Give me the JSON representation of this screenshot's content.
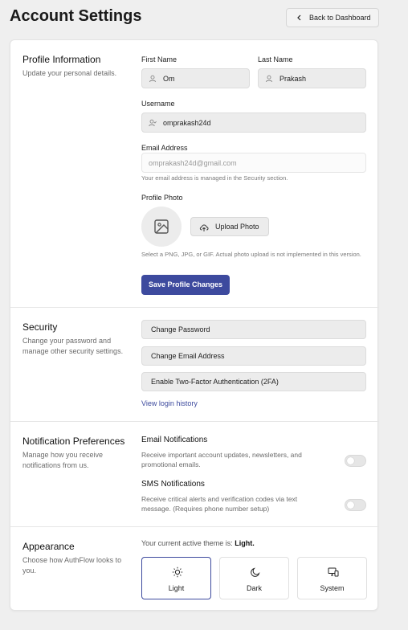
{
  "header": {
    "title": "Account Settings",
    "back_label": "Back to Dashboard"
  },
  "profile": {
    "title": "Profile Information",
    "description": "Update your personal details.",
    "first_name_label": "First Name",
    "first_name_value": "Om",
    "last_name_label": "Last Name",
    "last_name_value": "Prakash",
    "username_label": "Username",
    "username_value": "omprakash24d",
    "email_label": "Email Address",
    "email_value": "omprakash24d@gmail.com",
    "email_hint": "Your email address is managed in the Security section.",
    "photo_label": "Profile Photo",
    "upload_label": "Upload Photo",
    "photo_hint": "Select a PNG, JPG, or GIF. Actual photo upload is not implemented in this version.",
    "save_label": "Save Profile Changes"
  },
  "security": {
    "title": "Security",
    "description": "Change your password and manage other security settings.",
    "buttons": [
      "Change Password",
      "Change Email Address",
      "Enable Two-Factor Authentication (2FA)"
    ],
    "history_link": "View login history"
  },
  "notifications": {
    "title": "Notification Preferences",
    "description": "Manage how you receive notifications from us.",
    "email_title": "Email Notifications",
    "email_desc": "Receive important account updates, newsletters, and promotional emails.",
    "email_enabled": false,
    "sms_title": "SMS Notifications",
    "sms_desc": "Receive critical alerts and verification codes via text message. (Requires phone number setup)",
    "sms_enabled": false
  },
  "appearance": {
    "title": "Appearance",
    "description": "Choose how AuthFlow looks to you.",
    "current_prefix": "Your current active theme is:",
    "current_theme": "Light.",
    "themes": [
      {
        "label": "Light",
        "icon": "sun-icon",
        "active": true
      },
      {
        "label": "Dark",
        "icon": "moon-icon",
        "active": false
      },
      {
        "label": "System",
        "icon": "monitor-icon",
        "active": false
      }
    ]
  },
  "colors": {
    "accent": "#3d4a9e",
    "background": "#efefef",
    "card": "#ffffff"
  }
}
